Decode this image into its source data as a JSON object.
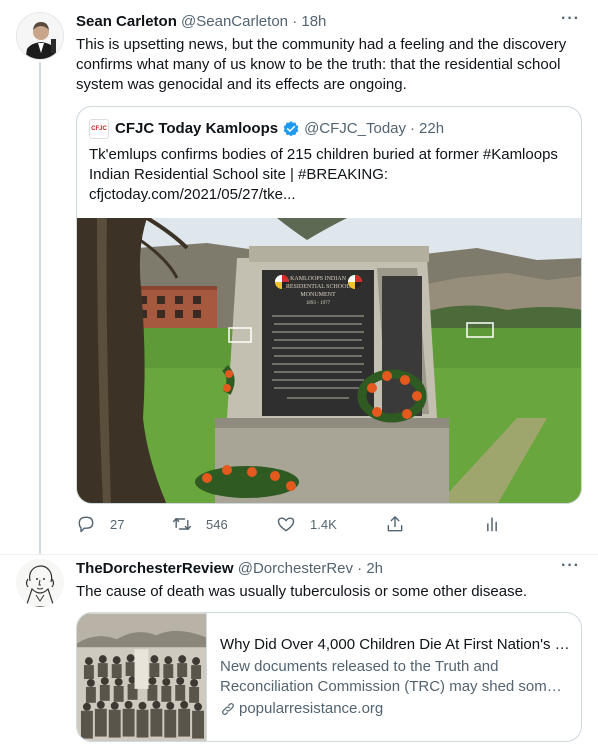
{
  "tweets": [
    {
      "name": "Sean Carleton",
      "handle": "@SeanCarleton",
      "separator": "·",
      "time": "18h",
      "more": "···",
      "text": "This is upsetting news, but the community had a feeling and the discovery confirms what many of us know to be the truth: that the residential school system was genocidal and its effects are ongoing.",
      "quote": {
        "avatar_text": "CFJC",
        "name": "CFJC Today Kamloops",
        "handle": "@CFJC_Today",
        "separator": "·",
        "time": "22h",
        "text": "Tk'emlups confirms bodies of 215 children buried at former #Kamloops Indian Residential School site | #BREAKING: cfjctoday.com/2021/05/27/tke...",
        "image": {
          "monument_lines": [
            "KAMLOOPS INDIAN",
            "RESIDENTIAL SCHOOL",
            "MONUMENT",
            "1893 - 1977"
          ]
        }
      },
      "actions": {
        "reply_count": "27",
        "retweet_count": "546",
        "like_count": "1.4K"
      }
    },
    {
      "name": "TheDorchesterReview",
      "handle": "@DorchesterRev",
      "separator": "·",
      "time": "2h",
      "more": "···",
      "text": "The cause of death was usually tuberculosis or some other disease.",
      "card": {
        "title": "Why Did Over 4,000 Children Die At First Nation's R...",
        "description": "New documents released to the Truth and Reconciliation Commission (TRC) may shed some ...",
        "domain": "popularresistance.org"
      }
    }
  ],
  "colors": {
    "text_primary": "#0f1419",
    "text_secondary": "#536471",
    "border": "#cfd9de",
    "verified": "#1d9bf0"
  }
}
